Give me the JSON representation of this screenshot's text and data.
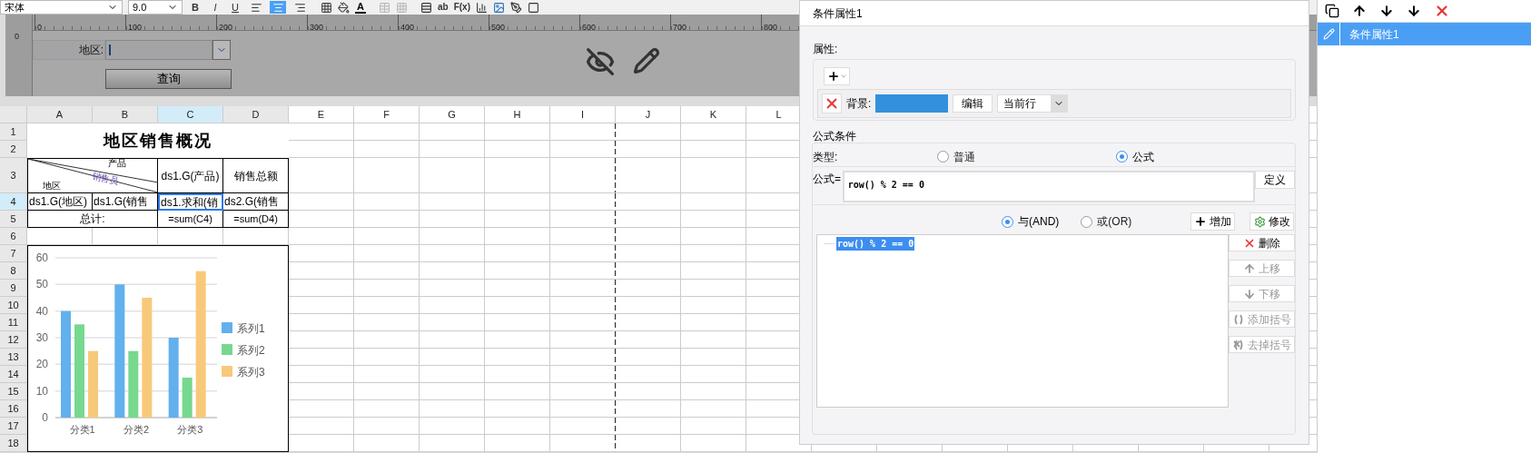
{
  "toolbar": {
    "font": "宋体",
    "size": "9.0",
    "style_buttons": [
      "B",
      "I",
      "U"
    ],
    "align_buttons": [
      {
        "selected": false
      },
      {
        "selected": true
      },
      {
        "selected": false
      }
    ],
    "font_color_label": "A",
    "text_buttons": [
      "ab",
      "F(x)"
    ]
  },
  "ruler": {
    "top_marks": [
      "0",
      "100",
      "200",
      "300",
      "400",
      "500",
      "600",
      "700",
      "800"
    ],
    "left_mark": "0"
  },
  "form": {
    "label": "地区:",
    "query_button": "查询"
  },
  "sheet": {
    "columns": [
      {
        "label": "A",
        "selected": false
      },
      {
        "label": "B",
        "selected": false
      },
      {
        "label": "C",
        "selected": true
      },
      {
        "label": "D",
        "selected": false
      },
      {
        "label": "E",
        "selected": false
      },
      {
        "label": "F",
        "selected": false
      },
      {
        "label": "G",
        "selected": false
      },
      {
        "label": "H",
        "selected": false
      },
      {
        "label": "I",
        "selected": false
      },
      {
        "label": "J",
        "selected": false
      },
      {
        "label": "K",
        "selected": false
      },
      {
        "label": "L",
        "selected": false
      }
    ],
    "rows": [
      {
        "label": "1",
        "selected": false
      },
      {
        "label": "2",
        "selected": false
      },
      {
        "label": "3",
        "selected": false
      },
      {
        "label": "4",
        "selected": true
      },
      {
        "label": "5",
        "selected": false
      },
      {
        "label": "6",
        "selected": false
      },
      {
        "label": "7",
        "selected": false
      },
      {
        "label": "8",
        "selected": false
      },
      {
        "label": "9",
        "selected": false
      },
      {
        "label": "10",
        "selected": false
      },
      {
        "label": "11",
        "selected": false
      },
      {
        "label": "12",
        "selected": false
      },
      {
        "label": "13",
        "selected": false
      },
      {
        "label": "14",
        "selected": false
      },
      {
        "label": "15",
        "selected": false
      },
      {
        "label": "16",
        "selected": false
      },
      {
        "label": "17",
        "selected": false
      },
      {
        "label": "18",
        "selected": false
      }
    ]
  },
  "report": {
    "title": "地区销售概况",
    "diagonal_labels": [
      "产品",
      "销售员",
      "地区"
    ],
    "product_header": "ds1.G(产品)",
    "total_header": "销售总额",
    "detail_row": [
      {
        "text": "ds1.G(地区)",
        "selected": false
      },
      {
        "text": "ds1.G(销售",
        "selected": false
      },
      {
        "text": "ds1.求和(销",
        "selected": true
      },
      {
        "text": "ds2.G(销售",
        "selected": false
      }
    ],
    "total_label": "总计:",
    "total_values": [
      "=sum(C4)",
      "=sum(D4)"
    ]
  },
  "chart": {
    "chart_data": {
      "type": "bar",
      "categories": [
        "分类1",
        "分类2",
        "分类3"
      ],
      "series": [
        {
          "name": "系列1",
          "color": "#62b0ed",
          "values": [
            40,
            50,
            30
          ]
        },
        {
          "name": "系列2",
          "color": "#77d88f",
          "values": [
            35,
            25,
            15
          ]
        },
        {
          "name": "系列3",
          "color": "#f8c97a",
          "values": [
            25,
            45,
            55
          ]
        }
      ],
      "ylim": [
        0,
        60
      ],
      "yticks": [
        0,
        10,
        20,
        30,
        40,
        50,
        60
      ],
      "grid": true,
      "legend": true
    }
  },
  "dialog": {
    "title": "条件属性1",
    "properties_group": {
      "label": "属性:",
      "property": {
        "name": "背景:",
        "color": "#3390dc",
        "edit_button": "编辑",
        "scope": "当前行"
      }
    },
    "formula_group": {
      "label": "公式条件",
      "type_label": "类型:",
      "types": [
        {
          "label": "普通",
          "selected": false
        },
        {
          "label": "公式",
          "selected": true
        }
      ],
      "formula_label": "公式=",
      "formula": "row() % 2 == 0",
      "define_button": "定义",
      "logic": [
        {
          "label": "与(AND)",
          "selected": true
        },
        {
          "label": "或(OR)",
          "selected": false
        }
      ],
      "add_button": "增加",
      "modify_button": "修改",
      "conditions": [
        {
          "label": "row() % 2 == 0",
          "selected": true
        }
      ],
      "actions": [
        {
          "label": "删除",
          "disabled": false
        },
        {
          "label": "上移",
          "disabled": true
        },
        {
          "label": "下移",
          "disabled": true
        },
        {
          "label": "添加括号",
          "disabled": true
        },
        {
          "label": "去掉括号",
          "disabled": true
        }
      ]
    }
  },
  "side_panel": {
    "items": [
      {
        "label": "条件属性1",
        "selected": true
      }
    ]
  }
}
